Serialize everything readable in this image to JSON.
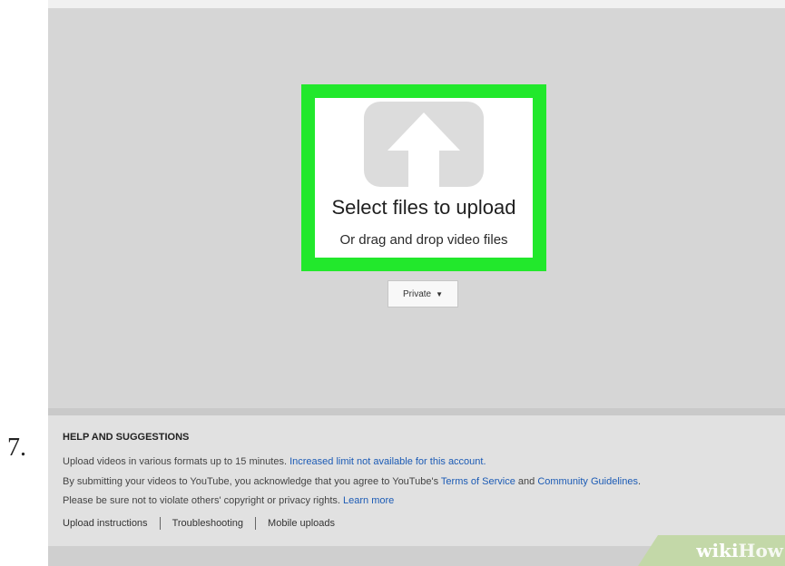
{
  "step": {
    "number": "7."
  },
  "upload": {
    "title": "Select files to upload",
    "subtitle": "Or drag and drop video files",
    "icon": "upload-arrow-icon",
    "highlight_color": "#22e82c"
  },
  "privacy": {
    "selected": "Private",
    "caret": "▼"
  },
  "help": {
    "title": "HELP AND SUGGESTIONS",
    "line1_text": "Upload videos in various formats up to 15 minutes. ",
    "line1_link": "Increased limit not available for this account.",
    "line2_text": "By submitting your videos to YouTube, you acknowledge that you agree to YouTube's ",
    "line2_link1": "Terms of Service",
    "line2_and": " and ",
    "line2_link2": "Community Guidelines",
    "line2_end": ".",
    "line3_text": "Please be sure not to violate others' copyright or privacy rights. ",
    "line3_link": "Learn more",
    "links": [
      "Upload instructions",
      "Troubleshooting",
      "Mobile uploads"
    ]
  },
  "watermark": {
    "part1": "wiki",
    "part2": "How"
  }
}
